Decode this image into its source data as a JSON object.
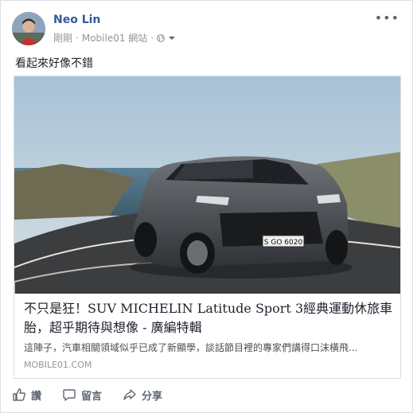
{
  "post": {
    "author": "Neo Lin",
    "meta_time": "剛剛",
    "meta_sep": "·",
    "meta_via": "Mobile01 網站",
    "message": "看起來好像不錯",
    "more_label": "•••",
    "icons": {
      "privacy": "globe-icon",
      "menu": "chevron-down-icon",
      "more": "more-dots-icon"
    }
  },
  "link": {
    "title": "不只是狂！SUV MICHELIN Latitude Sport 3經典運動休旅車胎，超乎期待與想像 - 廣編特輯",
    "description": "這陣子，汽車相關領域似乎已成了新顯學，談話節目裡的專家們講得口沫橫飛...",
    "domain": "MOBILE01.COM",
    "plate": "S GO 6020"
  },
  "actions": {
    "like": "讚",
    "comment": "留言",
    "share": "分享"
  },
  "colors": {
    "link_blue": "#365899",
    "meta_gray": "#90949c",
    "action_gray": "#606770"
  }
}
